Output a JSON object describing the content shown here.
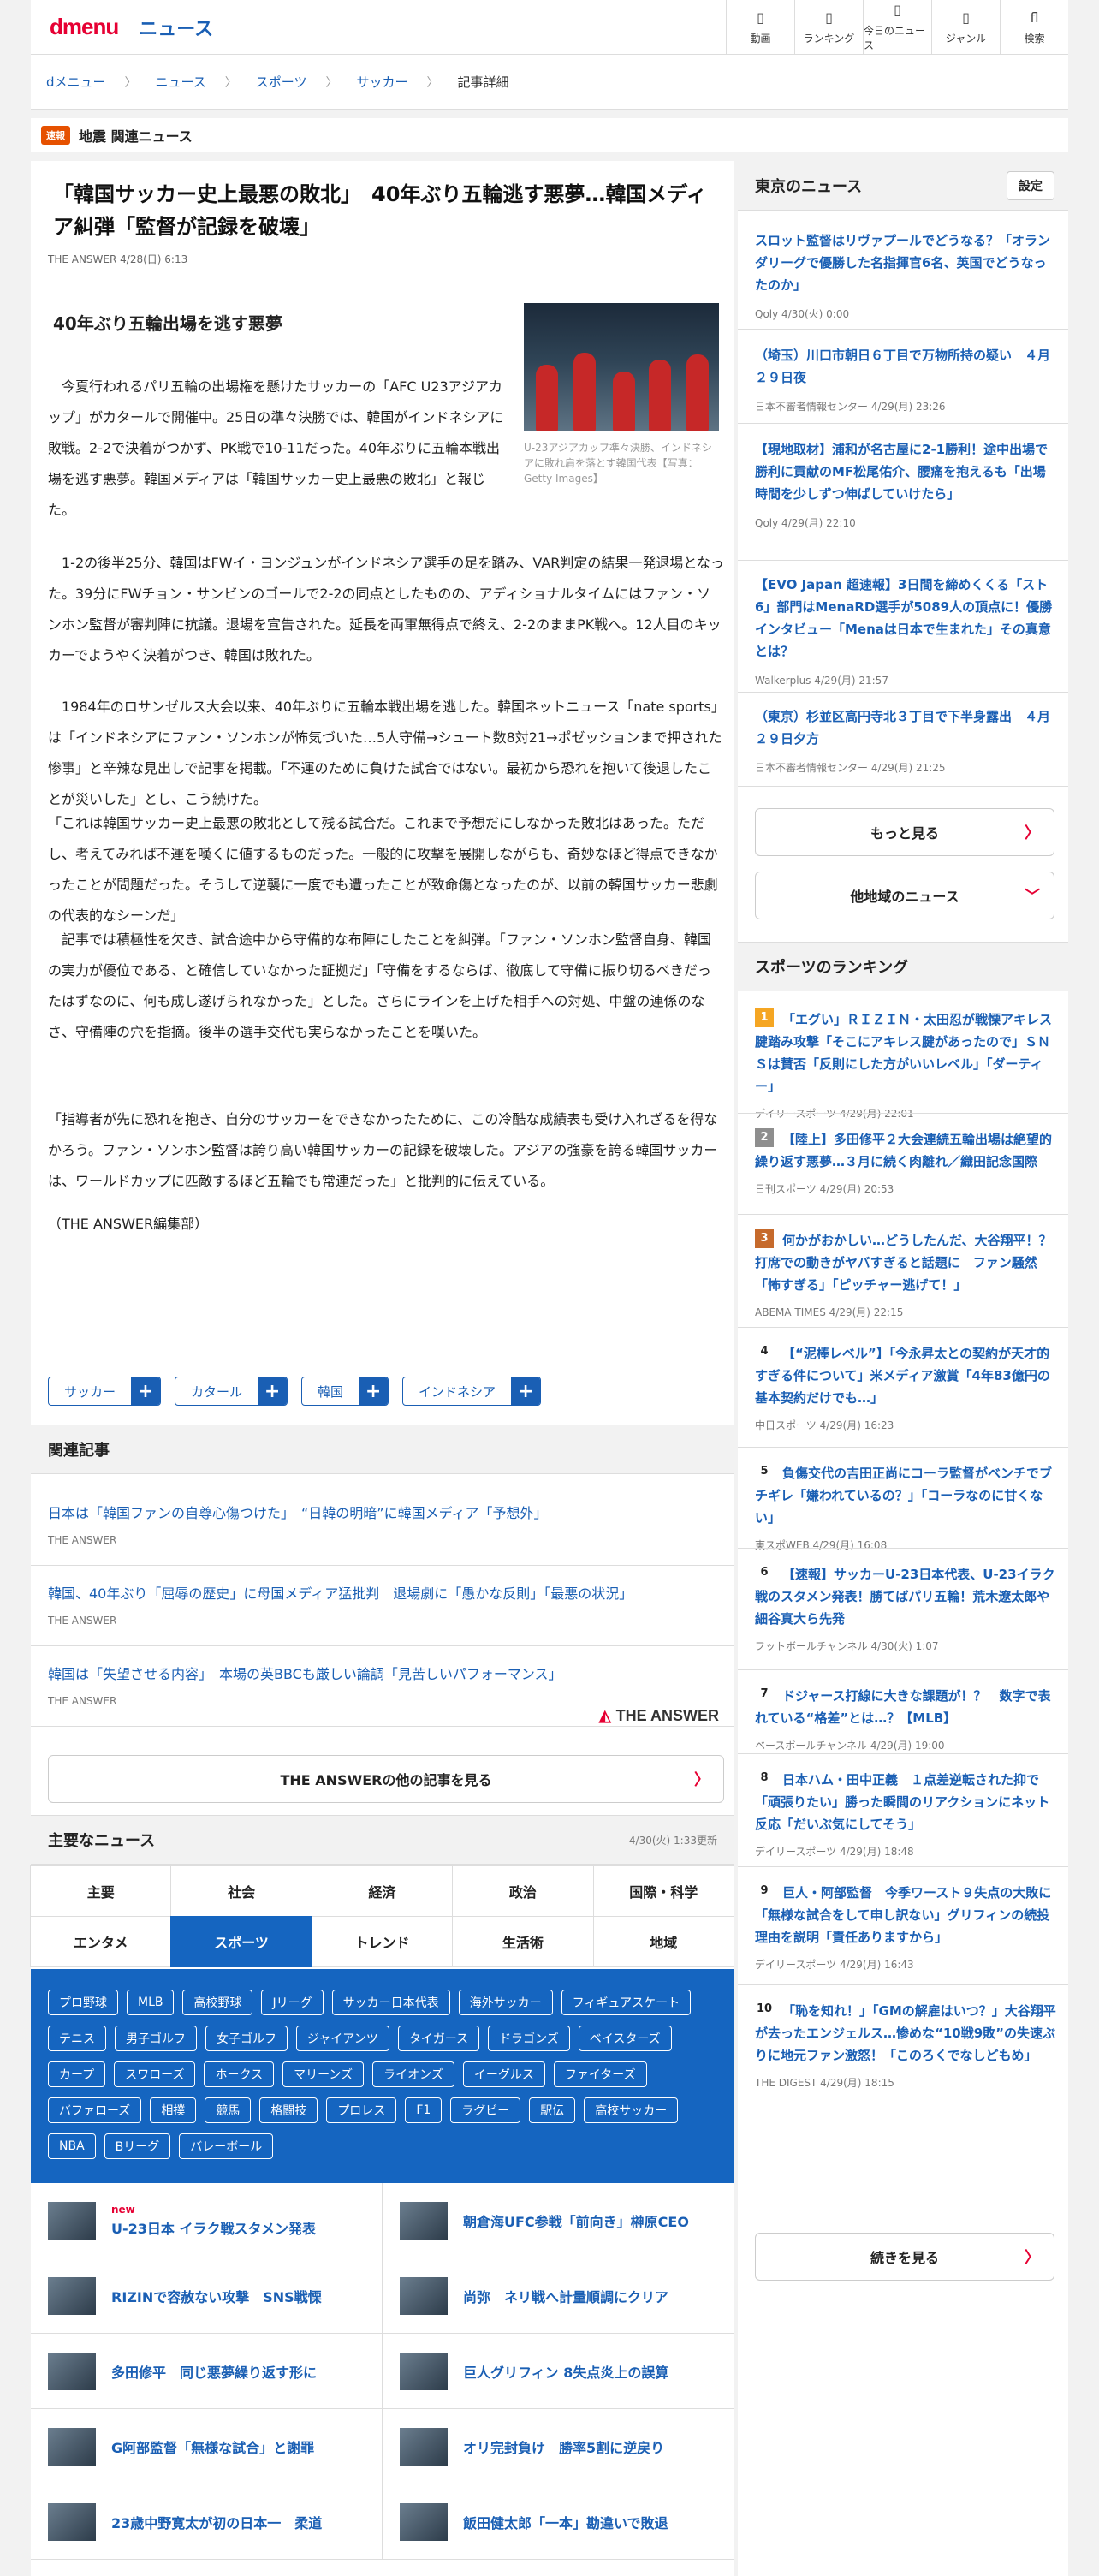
{
  "header": {
    "logo": "dmenu",
    "section": "ニュース",
    "nav": [
      {
        "icon": "video-icon",
        "label": "動画"
      },
      {
        "icon": "ranking-icon",
        "label": "ランキング"
      },
      {
        "icon": "today-news-icon",
        "label": "今日のニュース"
      },
      {
        "icon": "genre-icon",
        "label": "ジャンル"
      },
      {
        "icon": "search-icon",
        "label": "検索"
      }
    ]
  },
  "breadcrumb": [
    "dメニュー",
    "ニュース",
    "スポーツ",
    "サッカー",
    "記事詳細"
  ],
  "alert": {
    "badge": "速報",
    "text": "地震 関連ニュース"
  },
  "article": {
    "title": "「韓国サッカー史上最悪の敗北」　40年ぶり五輪逃す悪夢…韓国メディア糾弾「監督が記録を破壊」",
    "date": "THE ANSWER 4/28(日) 6:13",
    "subtitle": "40年ぶり五輪出場を逃す悪夢",
    "caption": "U-23アジアカップ準々決勝、インドネシアに敗れ肩を落とす韓国代表【写真：Getty Images】",
    "p1": "　今夏行われるパリ五輪の出場権を懸けたサッカーの「AFC U23アジアカップ」がカタールで開催中。25日の準々決勝では、韓国がインドネシアに敗戦。2-2で決着がつかず、PK戦で10-11だった。40年ぶりに五輪本戦出場を逃す悪夢。韓国メディアは「韓国サッカー史上最悪の敗北」と報じた。",
    "p2": "　1-2の後半25分、韓国はFWイ・ヨンジュンがインドネシア選手の足を踏み、VAR判定の結果一発退場となった。39分にFWチョン・サンビンのゴールで2-2の同点としたものの、アディショナルタイムにはファン・ソンホン監督が審判陣に抗議。退場を宣告された。延長を両軍無得点で終え、2-2のままPK戦へ。12人目のキッカーでようやく決着がつき、韓国は敗れた。",
    "p3": "　1984年のロサンゼルス大会以来、40年ぶりに五輪本戦出場を逃した。韓国ネットニュース「nate sports」は「インドネシアにファン・ソンホンが怖気づいた…5人守備→シュート数8対21→ポゼッションまで押された惨事」と辛辣な見出しで記事を掲載。「不運のために負けた試合ではない。最初から恐れを抱いて後退したことが災いした」とし、こう続けた。",
    "p4": "「これは韓国サッカー史上最悪の敗北として残る試合だ。これまで予想だにしなかった敗北はあった。ただし、考えてみれば不運を嘆くに値するものだった。一般的に攻撃を展開しながらも、奇妙なほど得点できなかったことが問題だった。そうして逆襲に一度でも遭ったことが致命傷となったのが、以前の韓国サッカー悲劇の代表的なシーンだ」",
    "p5": "　記事では積極性を欠き、試合途中から守備的な布陣にしたことを糾弾。「ファン・ソンホン監督自身、韓国の実力が優位である、と確信していなかった証拠だ」「守備をするならば、徹底して守備に振り切るべきだったはずなのに、何も成し遂げられなかった」とした。さらにラインを上げた相手への対処、中盤の連係のなさ、守備陣の穴を指摘。後半の選手交代も実らなかったことを嘆いた。",
    "p6": "「指導者が先に恐れを抱き、自分のサッカーをできなかったために、この冷酷な成績表も受け入れざるを得なかろう。ファン・ソンホン監督は誇り高い韓国サッカーの記録を破壊した。アジアの強豪を誇る韓国サッカーは、ワールドカップに匹敵するほど五輪でも常連だった」と批判的に伝えている。",
    "p7": "（THE ANSWER編集部）",
    "tags": [
      "サッカー",
      "カタール",
      "韓国",
      "インドネシア"
    ]
  },
  "related": {
    "heading": "関連記事",
    "items": [
      {
        "title": "日本は「韓国ファンの自尊心傷つけた」　“日韓の明暗”に韓国メディア「予想外」",
        "source": "THE ANSWER"
      },
      {
        "title": "韓国、40年ぶり「屈辱の歴史」に母国メディア猛批判　退場劇に「愚かな反則」「最悪の状況」",
        "source": "THE ANSWER"
      },
      {
        "title": "韓国は「失望させる内容」　本場の英BBCも厳しい論調「見苦しいパフォーマンス」",
        "source": "THE ANSWER"
      }
    ],
    "brand": "THE ANSWER",
    "more": "THE ANSWERの他の記事を見る"
  },
  "major": {
    "heading": "主要なニュース",
    "updated": "4/30(火) 1:33更新",
    "tabs": [
      "主要",
      "社会",
      "経済",
      "政治",
      "国際・科学",
      "エンタメ",
      "スポーツ",
      "トレンド",
      "生活術",
      "地域"
    ],
    "active": "スポーツ",
    "chips": [
      "プロ野球",
      "MLB",
      "高校野球",
      "Jリーグ",
      "サッカー日本代表",
      "海外サッカー",
      "フィギュアスケート",
      "テニス",
      "男子ゴルフ",
      "女子ゴルフ",
      "ジャイアンツ",
      "タイガース",
      "ドラゴンズ",
      "ベイスターズ",
      "カープ",
      "スワローズ",
      "ホークス",
      "マリーンズ",
      "ライオンズ",
      "イーグルス",
      "ファイターズ",
      "バファローズ",
      "相撲",
      "競馬",
      "格闘技",
      "プロレス",
      "F1",
      "ラグビー",
      "駅伝",
      "高校サッカー",
      "NBA",
      "Bリーグ",
      "バレーボール"
    ],
    "news": [
      {
        "title": "U-23日本 イラク戦スタメン発表",
        "new": "new"
      },
      {
        "title": "朝倉海UFC参戦「前向き」榊原CEO",
        "new": ""
      },
      {
        "title": "RIZINで容赦ない攻撃　SNS戦慄",
        "new": ""
      },
      {
        "title": "尚弥　ネリ戦へ計量順調にクリア",
        "new": ""
      },
      {
        "title": "多田修平　同じ悪夢繰り返す形に",
        "new": ""
      },
      {
        "title": "巨人グリフィン 8失点炎上の誤算",
        "new": ""
      },
      {
        "title": "G阿部監督「無様な試合」と謝罪",
        "new": ""
      },
      {
        "title": "オリ完封負け　勝率5割に逆戻り",
        "new": ""
      },
      {
        "title": "23歳中野寛太が初の日本一　柔道",
        "new": ""
      },
      {
        "title": "飯田健太郎「一本」勘違いで敗退",
        "new": ""
      }
    ]
  },
  "tokyo": {
    "heading": "東京のニュース",
    "settings": "設定",
    "items": [
      {
        "title": "スロット監督はリヴァプールでどうなる？「オランダリーグで優勝した名指揮官6名、英国でどうなったのか」",
        "source": "Qoly 4/30(火) 0:00"
      },
      {
        "title": "（埼玉）川口市朝日６丁目で万物所持の疑い　４月２９日夜",
        "source": "日本不審者情報センター 4/29(月) 23:26"
      },
      {
        "title": "【現地取材】浦和が名古屋に2-1勝利！途中出場で勝利に貢献のMF松尾佑介、腰痛を抱えるも「出場時間を少しずつ伸ばしていけたら」",
        "source": "Qoly 4/29(月) 22:10"
      },
      {
        "title": "【EVO Japan 超速報】3日間を締めくくる「スト6」部門はMenaRD選手が5089人の頂点に！優勝インタビュー「Menaは日本で生まれた」その真意とは？",
        "source": "Walkerplus 4/29(月) 21:57"
      },
      {
        "title": "（東京）杉並区高円寺北３丁目で下半身露出　４月２９日夕方",
        "source": "日本不審者情報センター 4/29(月) 21:25"
      }
    ],
    "more": "もっと見る",
    "other": "他地域のニュース"
  },
  "ranking": {
    "heading": "スポーツのランキング",
    "items": [
      {
        "rank": "1",
        "title": "「エグい」ＲＩＺＩＮ・太田忍が戦慄アキレス腱踏み攻撃「そこにアキレス腱があったので」ＳＮＳは賛否「反則にした方がいいレベル」「ダーティー」",
        "source": "デイリースポーツ 4/29(月) 22:01"
      },
      {
        "rank": "2",
        "title": "【陸上】多田修平２大会連続五輪出場は絶望的　繰り返す悪夢…３月に続く肉離れ／織田記念国際",
        "source": "日刊スポーツ 4/29(月) 20:53"
      },
      {
        "rank": "3",
        "title": "何かがおかしい…どうしたんだ、大谷翔平！？ 打席での動きがヤバすぎると話題に　ファン騒然「怖すぎる」「ピッチャー逃げて！」",
        "source": "ABEMA TIMES 4/29(月) 22:15"
      },
      {
        "rank": "4",
        "title": "【“泥棒レベル”】「今永昇太との契約が天才的すぎる件について」米メディア激賞「4年83億円の基本契約だけでも…」",
        "source": "中日スポーツ 4/29(月) 16:23"
      },
      {
        "rank": "5",
        "title": "負傷交代の吉田正尚にコーラ監督がベンチでブチギレ「嫌われているの？」「コーラなのに甘くない」",
        "source": "東スポWEB 4/29(月) 16:08"
      },
      {
        "rank": "6",
        "title": "【速報】サッカーU-23日本代表、U-23イラク戦のスタメン発表！勝てばパリ五輪！荒木遼太郎や細谷真大ら先発",
        "source": "フットボールチャンネル 4/30(火) 1:07"
      },
      {
        "rank": "7",
        "title": "ドジャース打線に大きな課題が！？　数字で表れている“格差”とは…？【MLB】",
        "source": "ベースボールチャンネル 4/29(月) 19:00"
      },
      {
        "rank": "8",
        "title": "日本ハム・田中正義　１点差逆転された抑で「頑張りたい」勝った瞬間のリアクションにネット反応「だいぶ気にしてそう」",
        "source": "デイリースポーツ 4/29(月) 18:48"
      },
      {
        "rank": "9",
        "title": "巨人・阿部監督　今季ワースト９失点の大敗に「無様な試合をして申し訳ない」グリフィンの続投理由を説明「責任ありますから」",
        "source": "デイリースポーツ 4/29(月) 16:43"
      },
      {
        "rank": "10",
        "title": "「恥を知れ！」「GMの解雇はいつ？」大谷翔平が去ったエンジェルス…惨めな“10戦9敗”の失速ぶりに地元ファン激怒！「このろくでなしどもめ」",
        "source": "THE DIGEST 4/29(月) 18:15"
      }
    ],
    "more": "続きを見る"
  },
  "colors": {
    "accent": "#1a5fb4",
    "brand": "#e60033",
    "active_tab": "#1565c0",
    "rank1": "#f5a623",
    "rank2": "#8e8e8e",
    "rank3": "#c66a2c"
  }
}
